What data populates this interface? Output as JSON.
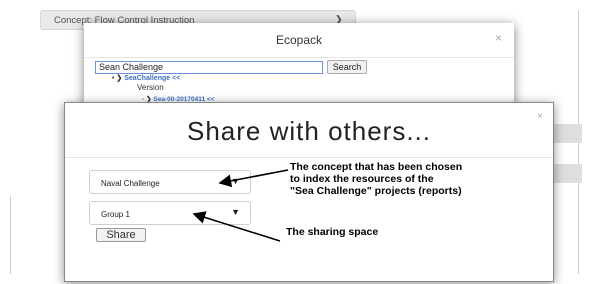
{
  "background": {
    "concept_label": "Concept: Flow Control Instruction"
  },
  "ecopack": {
    "title": "Ecopack",
    "close": "×",
    "search_value": "Sean Challenge",
    "search_button": "Search",
    "tree": {
      "root": "SeaChallenge",
      "version_label": "Version",
      "child": "Sea-00-20170411"
    }
  },
  "share_dialog": {
    "title": "Share with others...",
    "close": "×",
    "concept_select": "Naval Challenge",
    "group_select": "Group 1",
    "share_button": "Share"
  },
  "annotations": {
    "concept_note": [
      "The concept that has been chosen",
      "to index the resources of the",
      "\"Sea Challenge\" projects (reports)"
    ],
    "space_note": "The sharing space"
  }
}
